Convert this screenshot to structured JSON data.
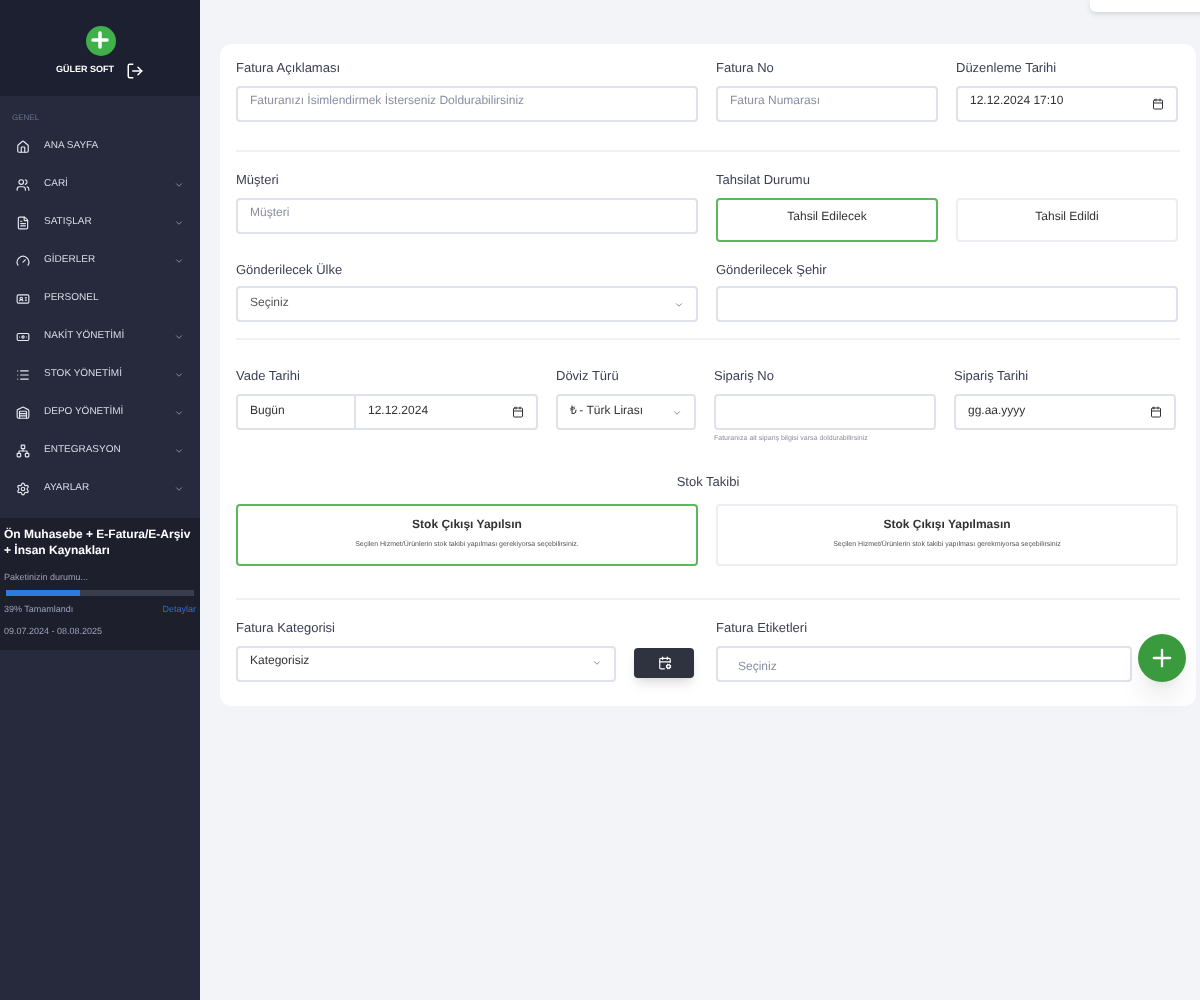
{
  "sidebar": {
    "user": "GÜLER SOFT",
    "section_label": "GENEL",
    "items": [
      {
        "label": "ANA SAYFA",
        "expandable": false
      },
      {
        "label": "CARİ",
        "expandable": true
      },
      {
        "label": "SATIŞLAR",
        "expandable": true
      },
      {
        "label": "GİDERLER",
        "expandable": true
      },
      {
        "label": "PERSONEL",
        "expandable": false
      },
      {
        "label": "NAKİT YÖNETİMİ",
        "expandable": true
      },
      {
        "label": "STOK YÖNETİMİ",
        "expandable": true
      },
      {
        "label": "DEPO YÖNETİMİ",
        "expandable": true
      },
      {
        "label": "ENTEGRASYON",
        "expandable": true
      },
      {
        "label": "AYARLAR",
        "expandable": true
      }
    ],
    "package": {
      "title": "Ön Muhasebe + E-Fatura/E-Arşiv + İnsan Kaynakları",
      "status": "Paketinizin durumu...",
      "level": 0.39,
      "percent": "39% Tamamlandı",
      "details": "Detaylar",
      "dates": "09.07.2024 - 08.08.2025"
    }
  },
  "form": {
    "invoice_description": {
      "label": "Fatura Açıklaması",
      "placeholder": "Faturanızı İsimlendirmek İsterseniz Doldurabilirsiniz"
    },
    "invoice_no": {
      "label": "Fatura No",
      "placeholder": "Fatura Numarası"
    },
    "issue_date": {
      "label": "Düzenleme Tarihi",
      "value": "12.12.2024 17:10"
    },
    "customer": {
      "label": "Müşteri",
      "placeholder": "Müşteri"
    },
    "collection_status": {
      "label": "Tahsilat Durumu",
      "options": [
        {
          "label": "Tahsil Edilecek",
          "selected": true
        },
        {
          "label": "Tahsil Edildi",
          "selected": false
        }
      ]
    },
    "country": {
      "label": "Gönderilecek Ülke",
      "value": "Seçiniz"
    },
    "city": {
      "label": "Gönderilecek Şehir"
    },
    "due_date": {
      "label": "Vade Tarihi",
      "preset": "Bugün",
      "value": "12.12.2024"
    },
    "currency": {
      "label": "Döviz Türü",
      "value": "₺ - Türk Lirası"
    },
    "order_no": {
      "label": "Sipariş No",
      "help": "Faturanıza ait sipariş bilgisi varsa doldurabilirsiniz"
    },
    "order_date": {
      "label": "Sipariş Tarihi",
      "placeholder": "gg.aa.yyyy"
    },
    "stock_tracking": {
      "label": "Stok Takibi",
      "options": [
        {
          "title": "Stok Çıkışı Yapılsın",
          "description": "Seçilen Hizmet/Ürünlerin stok takibi yapılması gerekiyorsa seçebilirsiniz.",
          "selected": true
        },
        {
          "title": "Stok Çıkışı Yapılmasın",
          "description": "Seçilen Hizmet/Ürünlerin stok takibi yapılması gerekmiyorsa seçebilirsiniz",
          "selected": false
        }
      ]
    },
    "category": {
      "label": "Fatura Kategorisi",
      "value": "Kategorisiz"
    },
    "tags": {
      "label": "Fatura Etiketleri",
      "placeholder": "Seçiniz"
    }
  }
}
